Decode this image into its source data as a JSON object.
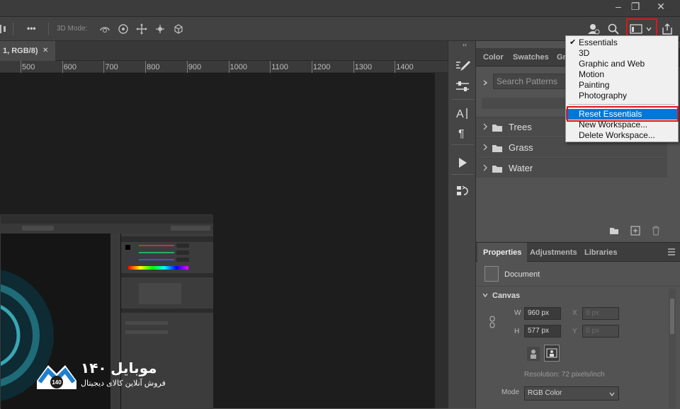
{
  "window": {
    "minimize_glyph": "‒",
    "restore_glyph": "❐",
    "close_glyph": "✕"
  },
  "options_bar": {
    "more_glyph": "•••",
    "mode_label": "3D Mode:"
  },
  "document_tab": {
    "title": "1, RGB/8)",
    "close_glyph": "✕"
  },
  "ruler": {
    "labels": [
      "500",
      "600",
      "700",
      "800",
      "900",
      "1000",
      "1100",
      "1200",
      "1300",
      "1400"
    ]
  },
  "collapse_glyph": "‹‹",
  "patterns_panel": {
    "tabs": [
      "Color",
      "Swatches",
      "Gr"
    ],
    "search_placeholder": "Search Patterns",
    "folders": [
      "Trees",
      "Grass",
      "Water"
    ]
  },
  "properties_panel": {
    "tabs": [
      "Properties",
      "Adjustments",
      "Libraries"
    ],
    "document_label": "Document",
    "section_canvas": "Canvas",
    "w_label": "W",
    "w_value": "960 px",
    "h_label": "H",
    "h_value": "577 px",
    "x_label": "X",
    "x_value": "0 px",
    "y_label": "Y",
    "y_value": "0 px",
    "resolution": "Resolution: 72 pixels/inch",
    "mode_label": "Mode",
    "mode_value": "RGB Color"
  },
  "workspace_menu": {
    "items": [
      "Essentials",
      "3D",
      "Graphic and Web",
      "Motion",
      "Painting",
      "Photography"
    ],
    "checked": "Essentials",
    "actions": [
      "Reset Essentials",
      "New Workspace...",
      "Delete Workspace..."
    ],
    "highlighted": "Reset Essentials"
  },
  "logo": {
    "brand": "موبایل ۱۴۰",
    "tagline": "فروش آنلاین کالای دیجیتال",
    "badge": "140"
  },
  "colors": {
    "highlight": "#0078d7",
    "annotation": "#e0141e",
    "logo_accent": "#1e7fd0"
  }
}
